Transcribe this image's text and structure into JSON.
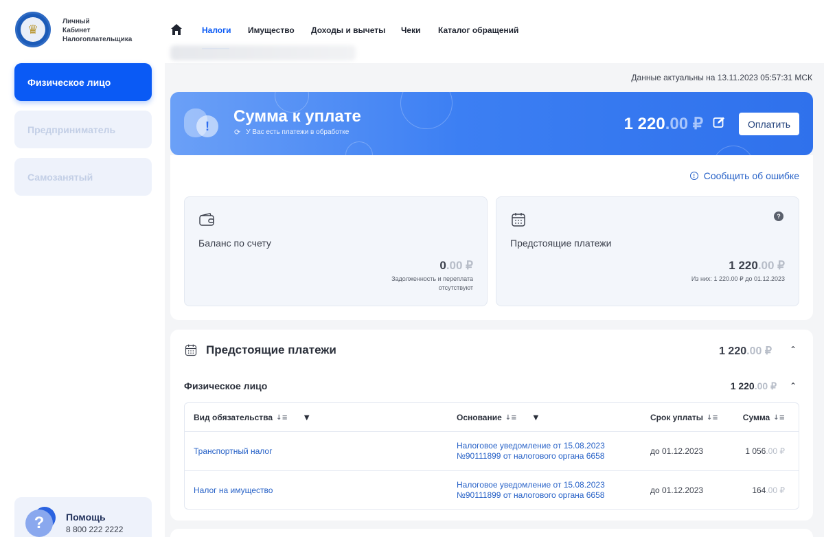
{
  "brand": {
    "line1": "Личный",
    "line2": "Кабинет",
    "line3": "Налогоплательщика"
  },
  "sidebar": {
    "items": [
      {
        "label": "Физическое лицо",
        "active": true
      },
      {
        "label": "Предприниматель",
        "active": false
      },
      {
        "label": "Самозанятый",
        "active": false
      }
    ],
    "help": {
      "title": "Помощь",
      "phone": "8 800 222 2222"
    }
  },
  "nav": {
    "items": [
      "Налоги",
      "Имущество",
      "Доходы и вычеты",
      "Чеки",
      "Каталог обращений"
    ],
    "active": "Налоги"
  },
  "data_actual": "Данные актуальны на 13.11.2023 05:57:31 МСК",
  "banner": {
    "title": "Сумма к уплате",
    "subtitle": "У Вас есть платежи в обработке",
    "amount_int": "1 220",
    "amount_dec": ".00 ₽",
    "pay_button": "Оплатить"
  },
  "summary": {
    "report_error": "Сообщить об ошибке",
    "balance": {
      "label": "Баланс по счету",
      "amount_int": "0",
      "amount_dec": ".00 ₽",
      "note_line1": "Задолженность и переплата",
      "note_line2": "отсутствуют"
    },
    "upcoming": {
      "label": "Предстоящие платежи",
      "amount_int": "1 220",
      "amount_dec": ".00 ₽",
      "note": "Из них: 1 220.00 ₽ до 01.12.2023"
    }
  },
  "payments": {
    "title": "Предстоящие платежи",
    "total_int": "1 220",
    "total_dec": ".00 ₽",
    "group": {
      "label": "Физическое лицо",
      "total_int": "1 220",
      "total_dec": ".00 ₽"
    },
    "columns": [
      "Вид обязательства",
      "Основание",
      "Срок уплаты",
      "Сумма"
    ],
    "rows": [
      {
        "type": "Транспортный налог",
        "basis_line1": "Налоговое уведомление от 15.08.2023",
        "basis_line2": "№90111899 от налогового органа 6658",
        "due": "до 01.12.2023",
        "sum_int": "1 056",
        "sum_dec": ".00 ₽"
      },
      {
        "type": "Налог на имущество",
        "basis_line1": "Налоговое уведомление от 15.08.2023",
        "basis_line2": "№90111899 от налогового органа 6658",
        "due": "до 01.12.2023",
        "sum_int": "164",
        "sum_dec": ".00 ₽"
      }
    ]
  },
  "colors": {
    "accent": "#0a5af5",
    "banner_from": "#6ba0f7",
    "banner_to": "#2f71ec",
    "link": "#2661c7"
  }
}
